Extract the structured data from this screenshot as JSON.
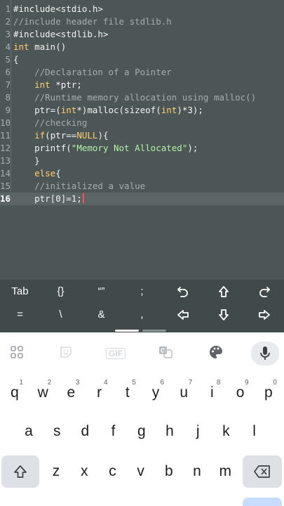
{
  "editor": {
    "lines": [
      {
        "n": "1",
        "parts": [
          {
            "t": "#include<stdio.h>",
            "c": "pre"
          }
        ]
      },
      {
        "n": "2",
        "parts": [
          {
            "t": "//include header file stdlib.h",
            "c": "com"
          }
        ]
      },
      {
        "n": "3",
        "parts": [
          {
            "t": "#include<stdlib.h>",
            "c": "pre"
          }
        ]
      },
      {
        "n": "4",
        "parts": [
          {
            "t": "int",
            "c": "kw"
          },
          {
            "t": " main()",
            "c": "pre"
          }
        ]
      },
      {
        "n": "5",
        "parts": [
          {
            "t": "{",
            "c": "pre"
          }
        ]
      },
      {
        "n": "6",
        "parts": [
          {
            "t": "    //Declaration of a Pointer",
            "c": "com"
          }
        ]
      },
      {
        "n": "7",
        "parts": [
          {
            "t": "    ",
            "c": "pre"
          },
          {
            "t": "int",
            "c": "kw"
          },
          {
            "t": " *ptr;",
            "c": "pre"
          }
        ]
      },
      {
        "n": "8",
        "parts": [
          {
            "t": "    //Runtime memory allocation using malloc()",
            "c": "com"
          }
        ]
      },
      {
        "n": "9",
        "parts": [
          {
            "t": "    ptr=(",
            "c": "pre"
          },
          {
            "t": "int",
            "c": "kw"
          },
          {
            "t": "*)malloc(sizeof(",
            "c": "pre"
          },
          {
            "t": "int",
            "c": "kw"
          },
          {
            "t": ")*3);",
            "c": "pre"
          }
        ]
      },
      {
        "n": "10",
        "parts": [
          {
            "t": "    //checking",
            "c": "com"
          }
        ]
      },
      {
        "n": "11",
        "parts": [
          {
            "t": "    ",
            "c": "pre"
          },
          {
            "t": "if",
            "c": "kw"
          },
          {
            "t": "(ptr==",
            "c": "pre"
          },
          {
            "t": "NULL",
            "c": "kw"
          },
          {
            "t": "){",
            "c": "pre"
          }
        ]
      },
      {
        "n": "12",
        "parts": [
          {
            "t": "    printf(",
            "c": "pre"
          },
          {
            "t": "\"Memory Not Allocated\"",
            "c": "str"
          },
          {
            "t": ");",
            "c": "pre"
          }
        ]
      },
      {
        "n": "13",
        "parts": [
          {
            "t": "    }",
            "c": "pre"
          }
        ]
      },
      {
        "n": "14",
        "parts": [
          {
            "t": "    ",
            "c": "pre"
          },
          {
            "t": "else",
            "c": "kw"
          },
          {
            "t": "{",
            "c": "pre"
          }
        ]
      },
      {
        "n": "15",
        "parts": [
          {
            "t": "    //initialized a value",
            "c": "com"
          }
        ]
      },
      {
        "n": "16",
        "parts": [
          {
            "t": "    ptr[0]=1;",
            "c": "pre"
          }
        ],
        "active": true,
        "caret": true
      }
    ]
  },
  "symbol_bar": {
    "row1": [
      {
        "name": "tab-key",
        "label": "Tab"
      },
      {
        "name": "braces-key",
        "label": "{}"
      },
      {
        "name": "quotes-key",
        "label": "“”"
      },
      {
        "name": "semicolon-key",
        "label": ";"
      },
      {
        "name": "undo-key",
        "icon": "undo-icon"
      },
      {
        "name": "arrow-up-key",
        "icon": "arrow-up-icon"
      },
      {
        "name": "redo-key",
        "icon": "redo-icon"
      }
    ],
    "row2": [
      {
        "name": "equals-key",
        "label": "="
      },
      {
        "name": "backslash-key",
        "label": "\\"
      },
      {
        "name": "ampersand-key",
        "label": "&"
      },
      {
        "name": "comma-key",
        "label": ","
      },
      {
        "name": "arrow-left-key",
        "icon": "arrow-left-icon"
      },
      {
        "name": "arrow-down-key",
        "icon": "arrow-down-icon"
      },
      {
        "name": "arrow-right-key",
        "icon": "arrow-right-icon"
      }
    ],
    "accent_color": "#ffffff"
  },
  "keyboard": {
    "toolbar": [
      {
        "name": "apps-grid-icon"
      },
      {
        "name": "sticker-icon"
      },
      {
        "name": "gif-button",
        "label": "GIF"
      },
      {
        "name": "translate-icon"
      },
      {
        "name": "palette-icon"
      },
      {
        "name": "microphone-icon"
      }
    ],
    "row1": [
      {
        "k": "q",
        "h": "1"
      },
      {
        "k": "w",
        "h": "2"
      },
      {
        "k": "e",
        "h": "3"
      },
      {
        "k": "r",
        "h": "4"
      },
      {
        "k": "t",
        "h": "5"
      },
      {
        "k": "y",
        "h": "6"
      },
      {
        "k": "u",
        "h": "7"
      },
      {
        "k": "i",
        "h": "8"
      },
      {
        "k": "o",
        "h": "9"
      },
      {
        "k": "p",
        "h": "0"
      }
    ],
    "row2": [
      "a",
      "s",
      "d",
      "f",
      "g",
      "h",
      "j",
      "k",
      "l"
    ],
    "row3": [
      "z",
      "x",
      "c",
      "v",
      "b",
      "n",
      "m"
    ],
    "colors": {
      "special_key": "#dde1e6",
      "bar": "#414a4a",
      "editor_bg": "#4d5656",
      "caret": "#ff4d5a",
      "keyword": "#ffd070",
      "string": "#b4f0a6"
    }
  }
}
